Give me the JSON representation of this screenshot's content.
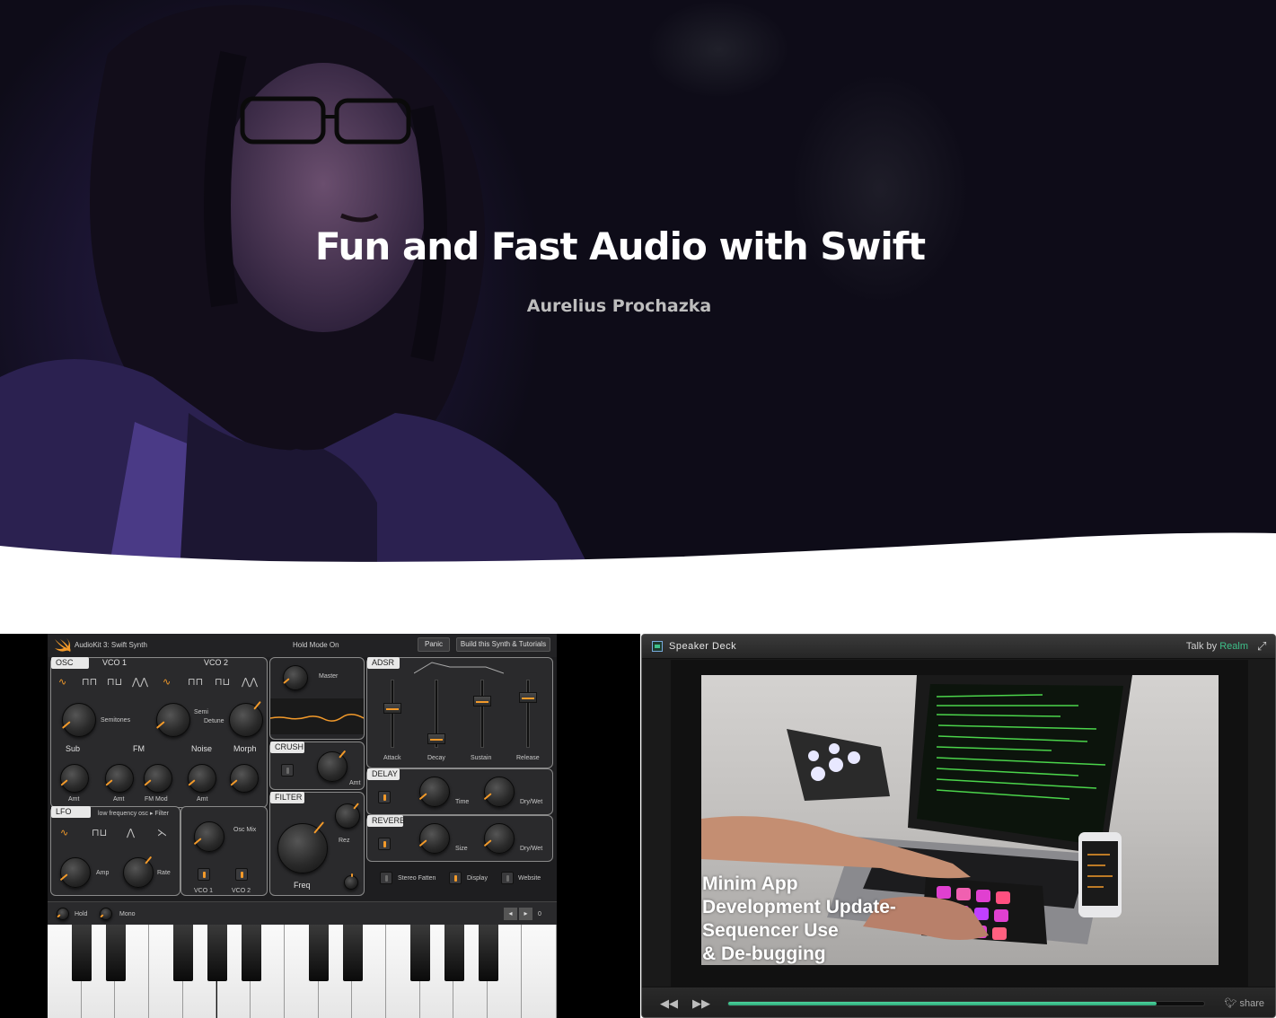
{
  "hero": {
    "title": "Fun and Fast Audio with Swift",
    "speaker": "Aurelius Prochazka"
  },
  "synth": {
    "app_name": "AudioKit 3: Swift Synth",
    "hold_mode": "Hold Mode On",
    "panic_label": "Panic",
    "build_label": "Build this Synth & Tutorials",
    "osc": {
      "tab": "OSC",
      "vco1": "VCO 1",
      "vco2": "VCO 2",
      "semitones": "Semitones",
      "semi": "Semi",
      "detune": "Detune"
    },
    "mix": {
      "sub": "Sub",
      "fm": "FM",
      "noise": "Noise",
      "morph": "Morph",
      "amt": "Amt",
      "fm_mod": "FM Mod"
    },
    "lfo": {
      "tab": "LFO",
      "desc": "low frequency osc  ▸ Filter",
      "amp": "Amp",
      "rate": "Rate",
      "osc_mix": "Osc Mix",
      "vco1": "VCO 1",
      "vco2": "VCO 2"
    },
    "master": "Master",
    "crush": {
      "tab": "CRUSH",
      "amt": "Amt"
    },
    "filter": {
      "tab": "FILTER",
      "rez": "Rez",
      "freq": "Freq"
    },
    "adsr": {
      "tab": "ADSR",
      "attack": "Attack",
      "decay": "Decay",
      "sustain": "Sustain",
      "release": "Release"
    },
    "delay": {
      "tab": "DELAY",
      "time": "Time",
      "drywet": "Dry/Wet"
    },
    "reverb": {
      "tab": "REVERB",
      "size": "Size",
      "drywet": "Dry/Wet"
    },
    "bottom": {
      "stereo": "Stereo Fatten",
      "display": "Display",
      "website": "Website"
    },
    "keys": {
      "hold": "Hold",
      "mono": "Mono",
      "octave": "0"
    },
    "accent": "#f39a2a"
  },
  "deck": {
    "title": "Speaker Deck",
    "talk_by": "Talk by",
    "realm": "Realm",
    "slide_text": [
      "Minim App",
      "Development Update-",
      "Sequencer Use",
      "& De-bugging"
    ],
    "share": "share",
    "progress": 0.9,
    "accent": "#3ec08a"
  }
}
